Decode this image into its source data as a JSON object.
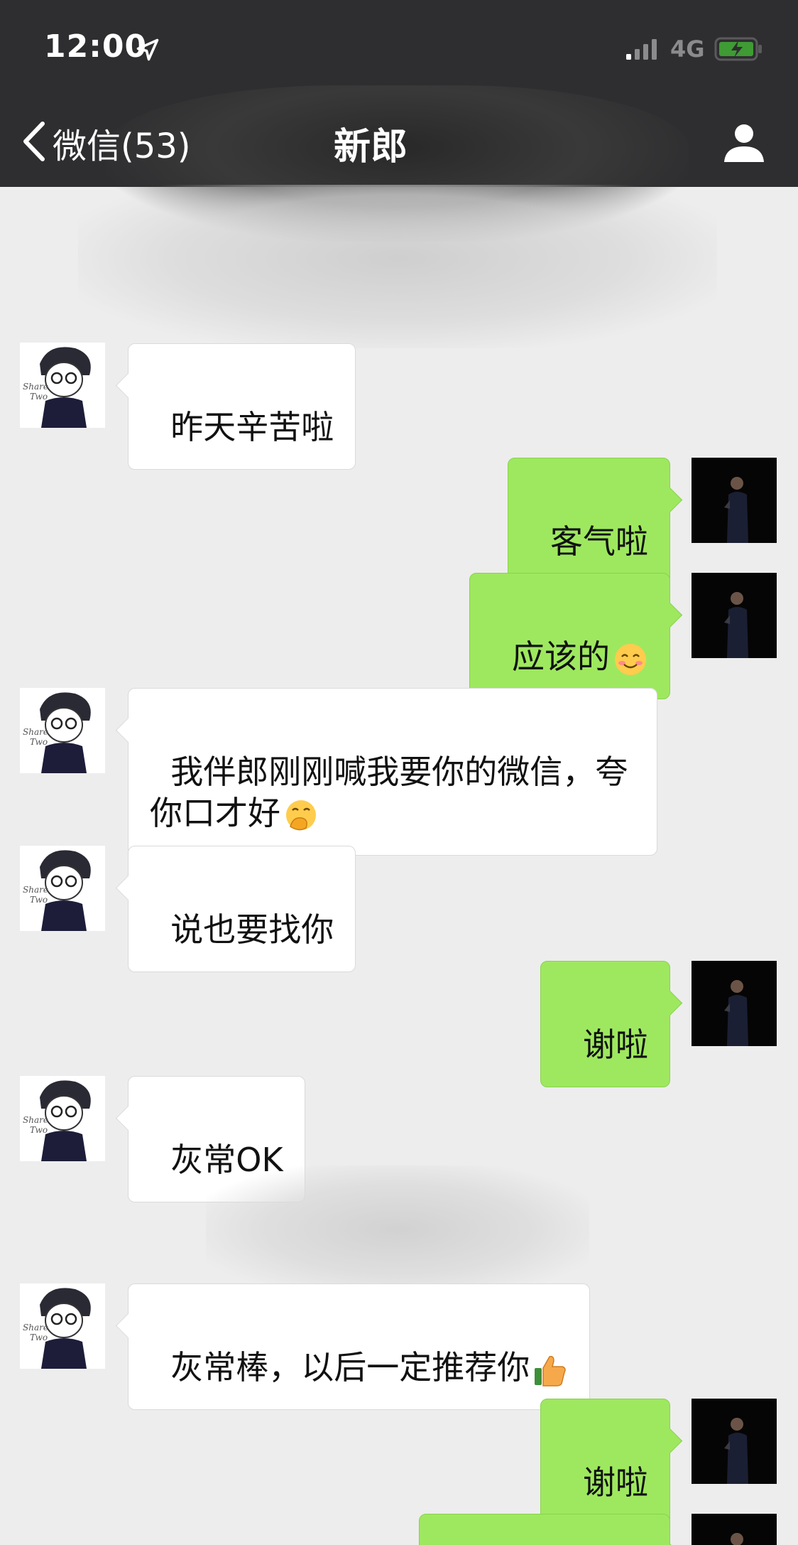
{
  "status_bar": {
    "time": "12:00",
    "network": "4G",
    "icons": [
      "location-arrow-icon",
      "signal-icon",
      "battery-charging-icon"
    ]
  },
  "nav": {
    "back_label": "微信(53)",
    "title": "新郎",
    "icons": [
      "chevron-left-icon",
      "profile-icon"
    ]
  },
  "colors": {
    "header_bg": "#2e2e30",
    "chat_bg": "#ededed",
    "self_bubble": "#9ee85f",
    "other_bubble": "#ffffff"
  },
  "messages": [
    {
      "side": "left",
      "text": "昨天辛苦啦"
    },
    {
      "side": "right",
      "text": "客气啦"
    },
    {
      "side": "right",
      "text": "应该的",
      "emoji": "smiling-blush-emoji-icon"
    },
    {
      "side": "left",
      "text": "我伴郎刚刚喊我要你的微信，夸\n你口才好",
      "emoji": "hand-over-mouth-emoji-icon"
    },
    {
      "side": "left",
      "text": "说也要找你"
    },
    {
      "side": "right",
      "text": "谢啦"
    },
    {
      "side": "left",
      "text": "灰常OK"
    },
    {
      "side": "left",
      "text": "灰常棒，以后一定推荐你",
      "emoji": "thumbs-up-emoji-icon"
    },
    {
      "side": "right",
      "text": "谢啦"
    },
    {
      "side": "right",
      "text": ""
    }
  ]
}
